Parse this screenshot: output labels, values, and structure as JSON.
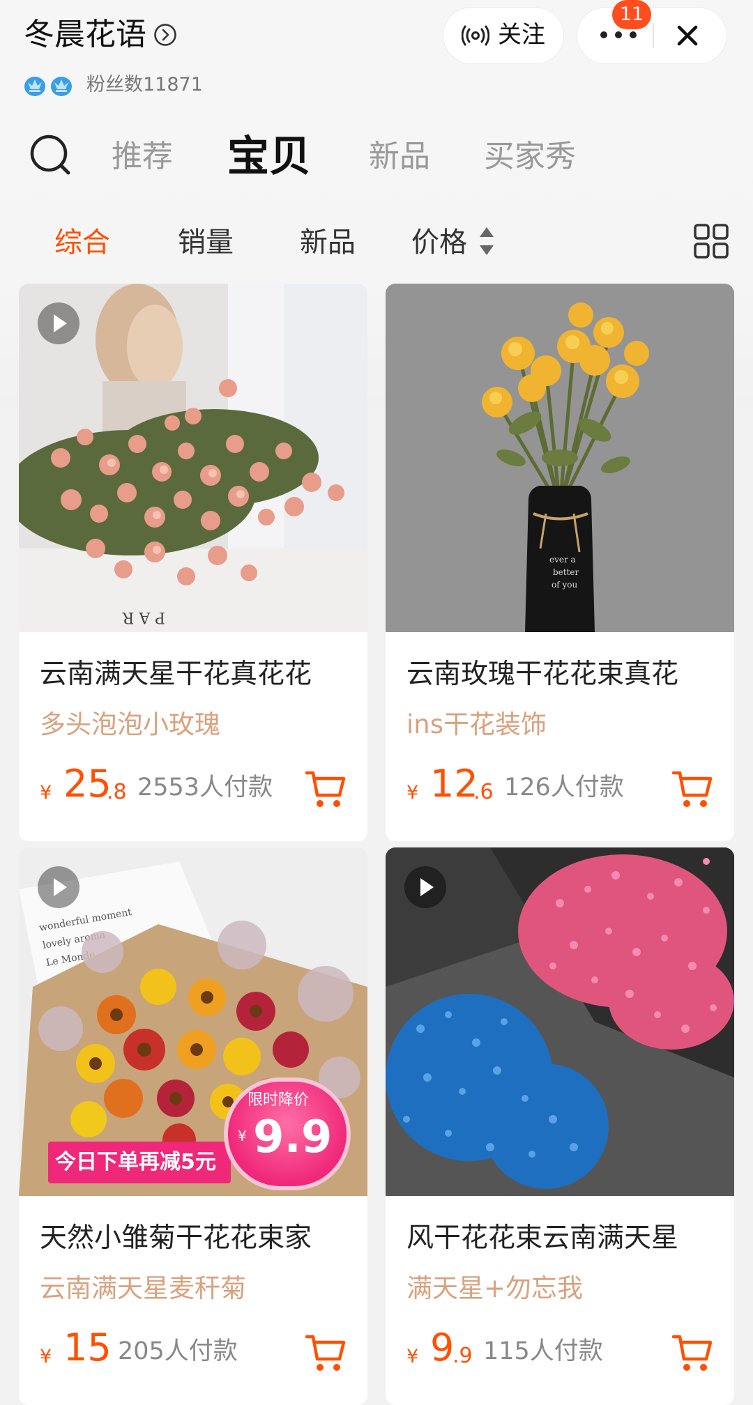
{
  "header": {
    "shop_name": "冬晨花语",
    "fans_label": "粉丝数11871",
    "follow_label": "关注",
    "notification_badge": "11"
  },
  "tabs": [
    {
      "label": "推荐",
      "active": false
    },
    {
      "label": "宝贝",
      "active": true
    },
    {
      "label": "新品",
      "active": false
    },
    {
      "label": "买家秀",
      "active": false
    }
  ],
  "sort": [
    {
      "label": "综合",
      "active": true
    },
    {
      "label": "销量",
      "active": false
    },
    {
      "label": "新品",
      "active": false
    },
    {
      "label": "价格",
      "active": false
    }
  ],
  "products": [
    {
      "title": "云南满天星干花真花花",
      "subtitle": "多头泡泡小玫瑰",
      "currency": "¥",
      "price_int": "25",
      "price_dec": ".8",
      "sold": "2553人付款",
      "has_video": true
    },
    {
      "title": "云南玫瑰干花花束真花",
      "subtitle": "ins干花装饰",
      "currency": "¥",
      "price_int": "12",
      "price_dec": ".6",
      "sold": "126人付款",
      "has_video": false
    },
    {
      "title": "天然小雏菊干花花束家",
      "subtitle": "云南满天星麦秆菊",
      "currency": "¥",
      "price_int": "15",
      "price_dec": "",
      "sold": "205人付款",
      "has_video": true
    },
    {
      "title": "风干花花束云南满天星",
      "subtitle": "满天星+勿忘我",
      "currency": "¥",
      "price_int": "9",
      "price_dec": ".9",
      "sold": "115人付款",
      "has_video": true
    }
  ],
  "promo": {
    "banner_text": "今日下单再减5元",
    "circle_label": "限时降价",
    "circle_currency": "¥",
    "circle_price": "9.9"
  },
  "colors": {
    "accent": "#ff5000",
    "subtitle": "#d9a27e",
    "promo_pink": "#f0287a"
  }
}
